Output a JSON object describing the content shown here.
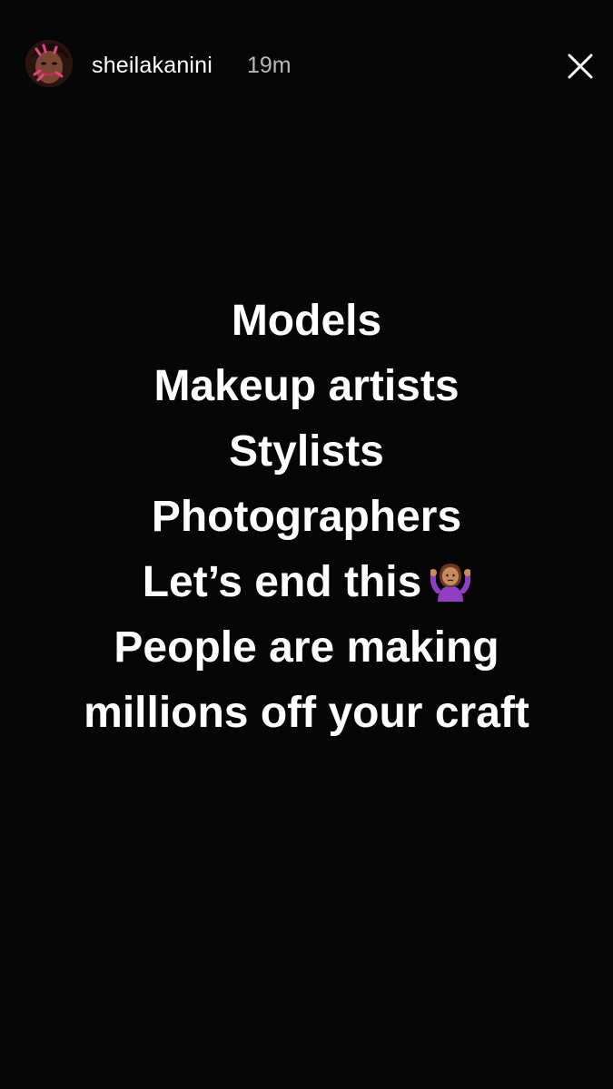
{
  "header": {
    "username": "sheilakanini",
    "timestamp": "19m",
    "avatar_icon": "profile-avatar",
    "close_icon": "close-icon"
  },
  "story_text": {
    "lines": [
      "Models",
      "Makeup artists",
      "Stylists",
      "Photographers",
      "Let’s end this",
      "People are making",
      "millions off your craft"
    ],
    "emoji": "person-shrugging-emoji"
  },
  "colors": {
    "background": "#060606",
    "text": "#ffffff",
    "timestamp": "#b9b9b9",
    "emoji_shirt": "#8e3fc4",
    "emoji_skin": "#c98b5f"
  }
}
